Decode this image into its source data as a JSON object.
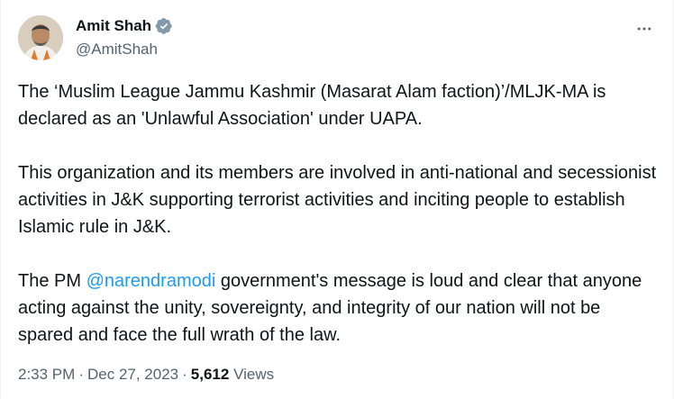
{
  "author": {
    "display_name": "Amit Shah",
    "handle": "@AmitShah",
    "verified_badge_icon": "verified-check-icon",
    "badge_color": "#829aab"
  },
  "menu": {
    "icon": "more-horizontal-icon"
  },
  "tweet": {
    "paragraph_1": "The ‘Muslim League Jammu Kashmir (Masarat Alam faction)’/MLJK-MA is declared as an 'Unlawful Association' under UAPA.",
    "paragraph_2": "This organization and its members are involved in anti-national and secessionist activities in J&K supporting terrorist activities and inciting people to establish Islamic rule in J&K.",
    "paragraph_3_before": "The PM ",
    "mention": "@narendramodi",
    "paragraph_3_after": " government's message is loud and clear that anyone acting against the unity, sovereignty, and integrity of our nation will not be spared and face the full wrath of the law."
  },
  "meta": {
    "time": "2:33 PM",
    "separator": "·",
    "date": "Dec 27, 2023",
    "views_count": "5,612",
    "views_label": "Views"
  },
  "colors": {
    "text": "#0f1419",
    "secondary": "#536471",
    "link": "#1d9bf0"
  }
}
